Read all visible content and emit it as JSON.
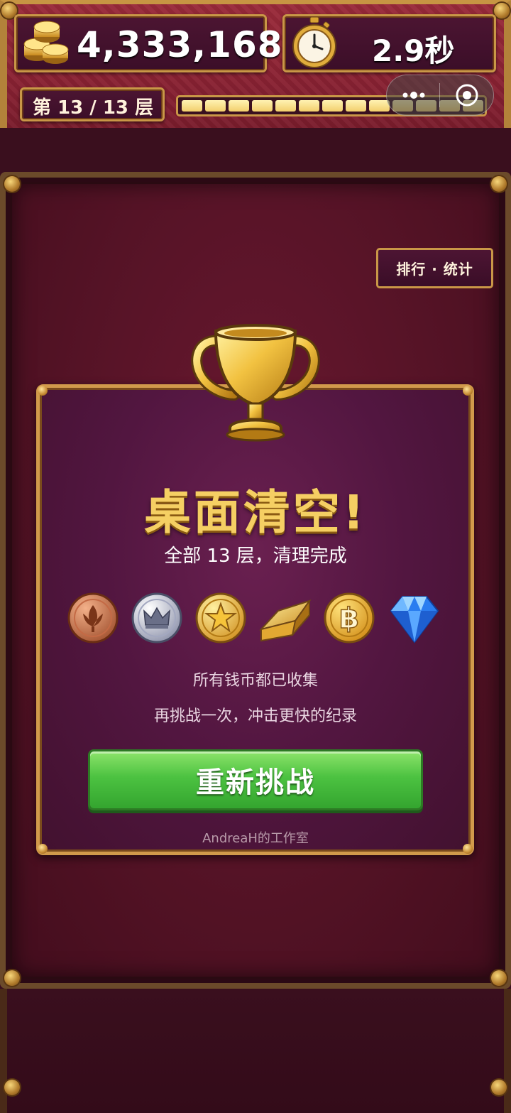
{
  "hud": {
    "coins": "4,333,168",
    "timer": "2.9秒",
    "level": "第 13 / 13 层",
    "progress_filled": 13,
    "progress_total": 13
  },
  "buttons": {
    "rank_stats": "排行 · 统计",
    "retry": "重新挑战"
  },
  "dialog": {
    "title": "桌面清空!",
    "subtitle": "全部 13 层，清理完成",
    "collected": "所有钱币都已收集",
    "encourage": "再挑战一次，冲击更快的纪录",
    "credit": "AndreaH的工作室"
  },
  "icons": {
    "coin_stack": "coin-stack-icon",
    "stopwatch": "stopwatch-icon",
    "trophy": "trophy-icon",
    "currencies": [
      "bronze-leaf-coin-icon",
      "silver-crown-coin-icon",
      "gold-star-coin-icon",
      "gold-bar-icon",
      "bitcoin-icon",
      "diamond-icon"
    ]
  },
  "colors": {
    "accent_gold": "#f5cf63",
    "panel_border": "#c99747",
    "retry_green": "#4cc241",
    "board_red": "#551326"
  }
}
